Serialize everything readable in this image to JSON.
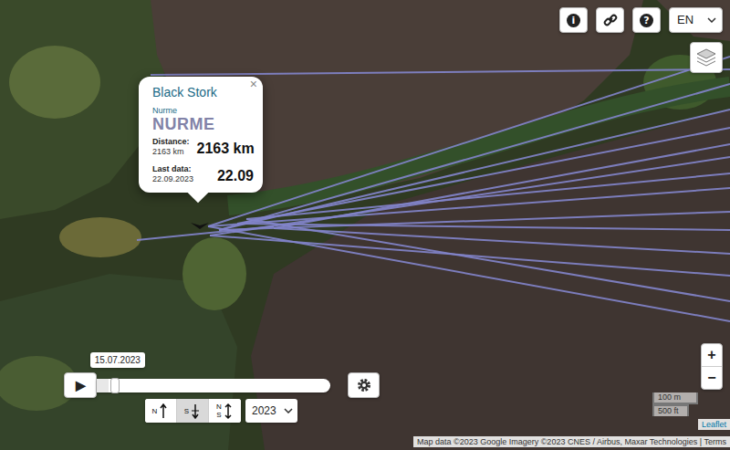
{
  "toolbar": {
    "info": "i",
    "help": "?",
    "language": "EN"
  },
  "popup": {
    "title": "Black Stork",
    "close": "×",
    "subtitle": "Nurme",
    "name": "NURME",
    "distance_label": "Distance:",
    "distance_small": "2163 km",
    "distance_big": "2163 km",
    "last_label": "Last data:",
    "last_small": "22.09.2023",
    "last_big": "22.09"
  },
  "zoom": [
    "+",
    "−"
  ],
  "scale": [
    "100 m",
    "500 ft"
  ],
  "timeline": {
    "play": "▶",
    "date": "15.07.2023",
    "level": 0.05
  },
  "direction_buttons": [
    {
      "labels": [
        "N"
      ],
      "selected": false
    },
    {
      "labels": [
        "S"
      ],
      "selected": true
    },
    {
      "labels": [
        "N",
        "S"
      ],
      "selected": false
    }
  ],
  "year": "2023",
  "attribution": {
    "leaflet": "Leaflet",
    "text": "Map data ©2023 Google Imagery ©2023 CNES / Airbus, Maxar Technologies",
    "separator": "|",
    "terms": "Terms"
  }
}
